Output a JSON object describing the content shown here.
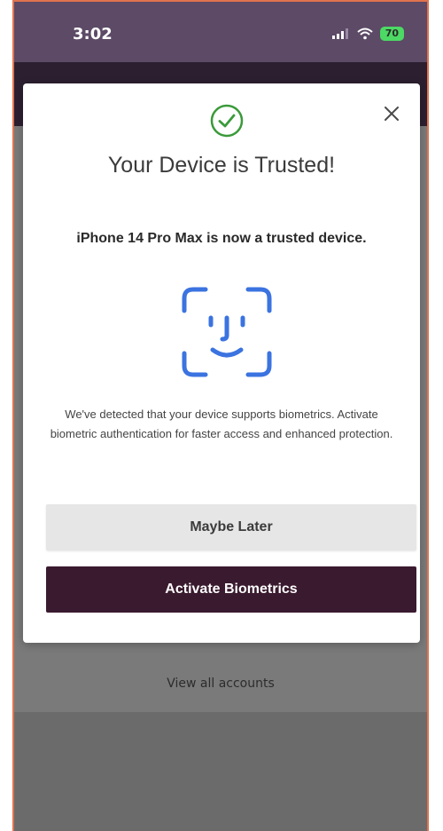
{
  "status_bar": {
    "time": "3:02",
    "battery": "70",
    "icons": [
      "signal-icon",
      "wifi-icon",
      "battery-icon"
    ]
  },
  "modal": {
    "title": "Your Device is Trusted!",
    "subtitle": "iPhone 14 Pro Max is now a trusted device.",
    "description": "We've detected that your device supports biometrics. Activate biometric authentication for faster access and enhanced protection.",
    "maybe_later_label": "Maybe Later",
    "activate_label": "Activate Biometrics",
    "icons": [
      "check-circle-icon",
      "close-icon",
      "face-id-icon"
    ]
  },
  "background": {
    "view_all_label": "View all accounts"
  },
  "colors": {
    "status_bar": "#5c4a66",
    "success_green": "#3a9a3a",
    "face_id_blue": "#3b73e0",
    "primary_button": "#3a1a2e",
    "secondary_button": "#e6e6e6",
    "frame_border": "#e0734f"
  }
}
